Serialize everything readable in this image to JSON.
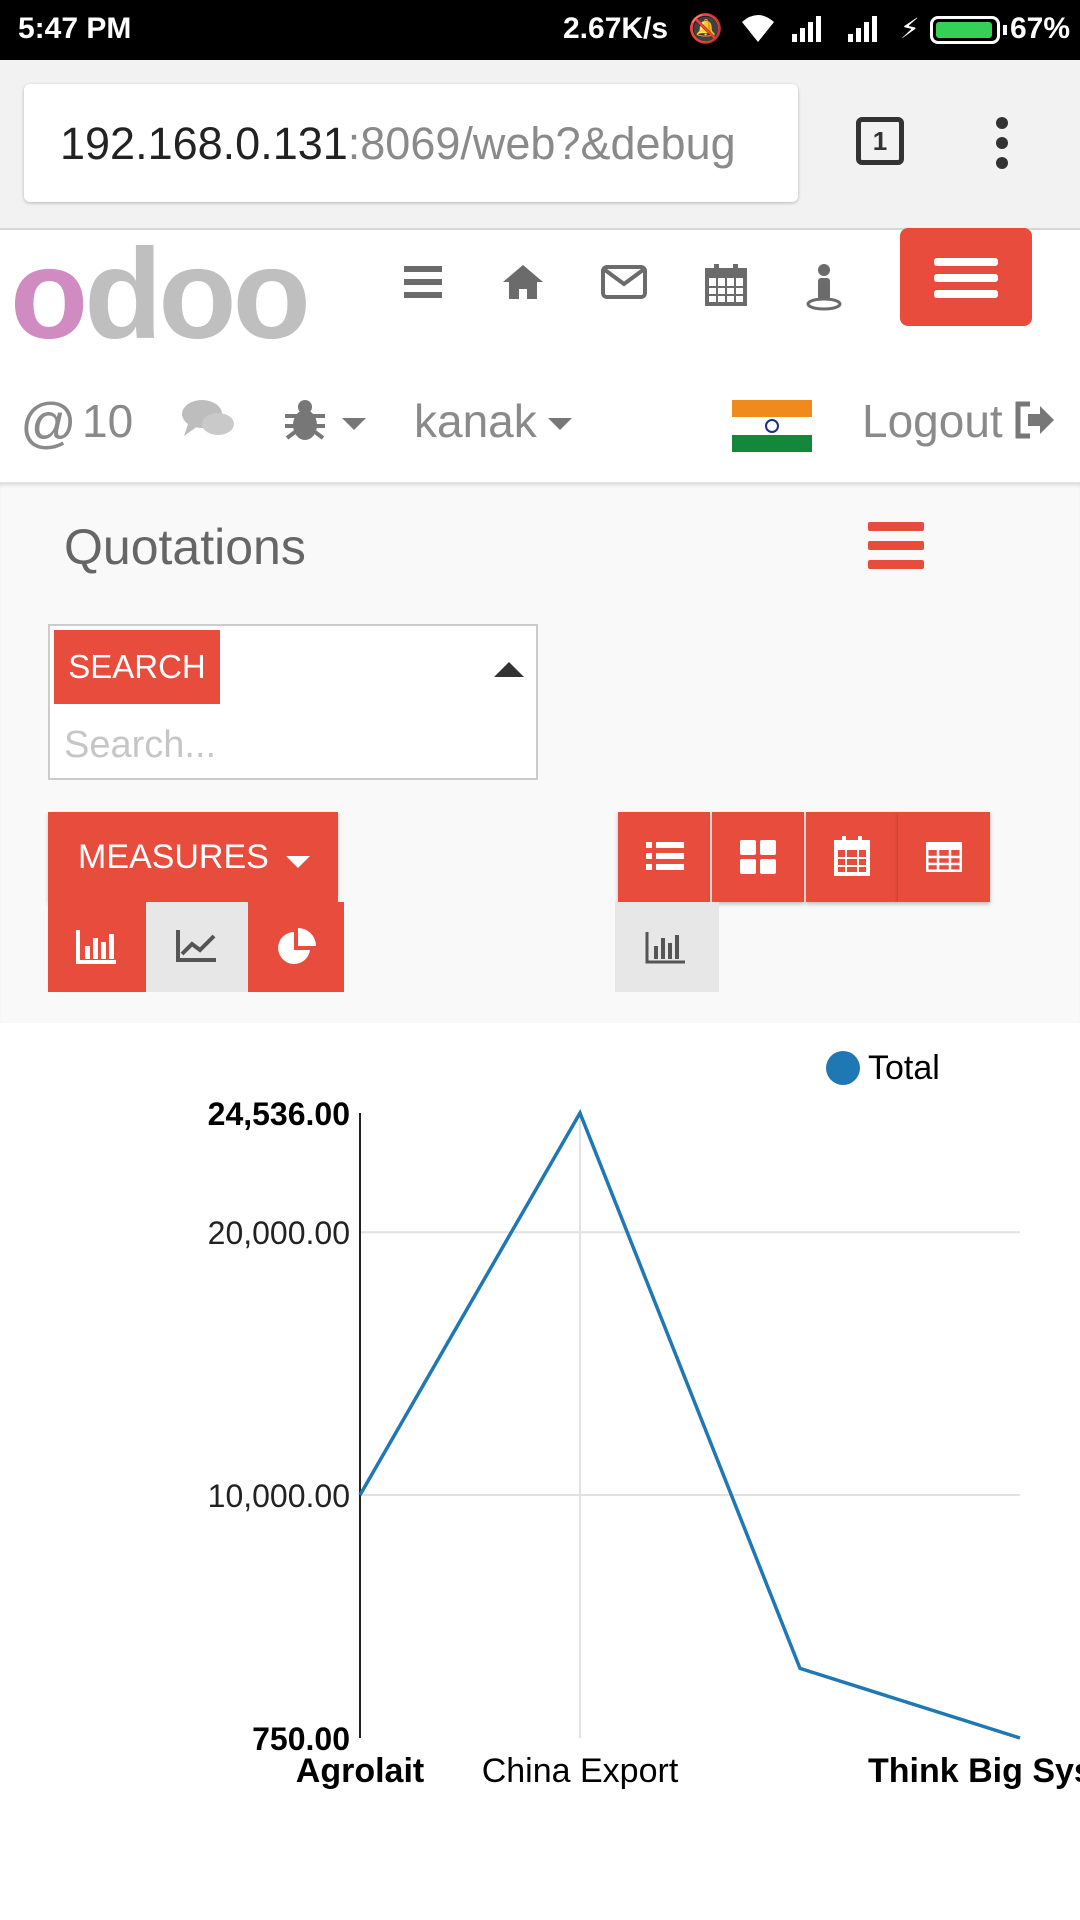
{
  "status_bar": {
    "time": "5:47 PM",
    "network_speed": "2.67K/s",
    "battery": "67%"
  },
  "browser": {
    "url_host": "192.168.0.131",
    "url_rest": ":8069/web?&debug",
    "tab_count": "1"
  },
  "header": {
    "logo_first": "o",
    "logo_rest": "doo",
    "icons": [
      "menu-icon",
      "home-icon",
      "mail-icon",
      "calendar-icon",
      "user-icon"
    ],
    "mention_count": "10",
    "username": "kanak",
    "logout_label": "Logout"
  },
  "control_panel": {
    "title": "Quotations",
    "search_button": "SEARCH",
    "search_placeholder": "Search...",
    "measures_label": "MEASURES"
  },
  "colors": {
    "accent": "#e84c3d",
    "series": "#1f77b4"
  },
  "chart_data": {
    "type": "line",
    "categories": [
      "Agrolait",
      "China Export",
      "Think Big Sys"
    ],
    "x": [
      "Agrolait",
      "China Export",
      "",
      "Think Big Sys"
    ],
    "series": [
      {
        "name": "Total",
        "values": [
          10000,
          24536,
          3400,
          750
        ]
      }
    ],
    "y_ticks": [
      "24,536.00",
      "20,000.00",
      "10,000.00",
      "750.00"
    ],
    "ylim": [
      750,
      24536
    ],
    "legend_position": "top-right",
    "grid": true
  }
}
